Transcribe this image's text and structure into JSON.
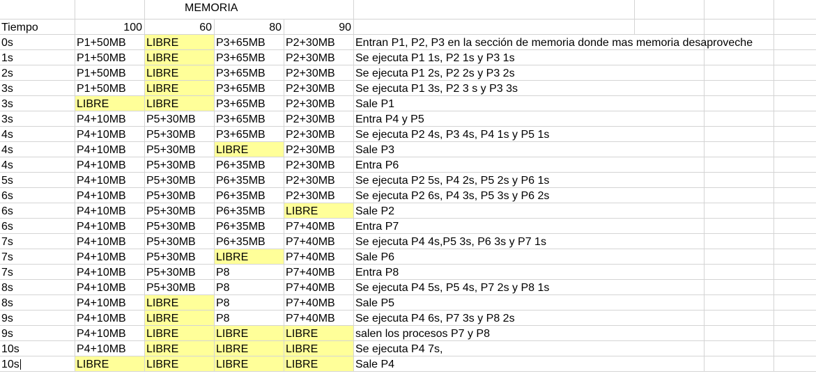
{
  "memoria_label": "MEMORIA",
  "header": {
    "tiempo": "Tiempo",
    "sizes": [
      "100",
      "60",
      "80",
      "90"
    ]
  },
  "rows": [
    {
      "t": "0s",
      "m": [
        "P1+50MB",
        "LIBRE",
        "P3+65MB",
        "P2+30MB"
      ],
      "note": "Entran P1, P2, P3 en la sección de memoria donde mas memoria desaproveche"
    },
    {
      "t": "1s",
      "m": [
        "P1+50MB",
        "LIBRE",
        "P3+65MB",
        "P2+30MB"
      ],
      "note": "Se ejecuta P1 1s, P2 1s y P3 1s"
    },
    {
      "t": "2s",
      "m": [
        "P1+50MB",
        "LIBRE",
        "P3+65MB",
        "P2+30MB"
      ],
      "note": "Se ejecuta P1 2s, P2 2s y P3 2s"
    },
    {
      "t": "3s",
      "m": [
        "P1+50MB",
        "LIBRE",
        "P3+65MB",
        "P2+30MB"
      ],
      "note": "Se ejecuta P1 3s, P2 3 s y P3 3s"
    },
    {
      "t": "3s",
      "m": [
        "LIBRE",
        "LIBRE",
        "P3+65MB",
        "P2+30MB"
      ],
      "note": "Sale P1"
    },
    {
      "t": "3s",
      "m": [
        "P4+10MB",
        "P5+30MB",
        "P3+65MB",
        "P2+30MB"
      ],
      "note": "Entra P4 y P5"
    },
    {
      "t": "4s",
      "m": [
        "P4+10MB",
        "P5+30MB",
        "P3+65MB",
        "P2+30MB"
      ],
      "note": "Se ejecuta P2 4s, P3 4s, P4 1s y P5 1s"
    },
    {
      "t": "4s",
      "m": [
        "P4+10MB",
        "P5+30MB",
        "LIBRE",
        "P2+30MB"
      ],
      "note": "Sale P3"
    },
    {
      "t": "4s",
      "m": [
        "P4+10MB",
        "P5+30MB",
        "P6+35MB",
        "P2+30MB"
      ],
      "note": "Entra P6"
    },
    {
      "t": "5s",
      "m": [
        "P4+10MB",
        "P5+30MB",
        "P6+35MB",
        "P2+30MB"
      ],
      "note": "Se ejecuta P2 5s, P4 2s, P5 2s y P6 1s"
    },
    {
      "t": "6s",
      "m": [
        "P4+10MB",
        "P5+30MB",
        "P6+35MB",
        "P2+30MB"
      ],
      "note": "Se ejecuta P2 6s, P4 3s, P5 3s y P6 2s"
    },
    {
      "t": "6s",
      "m": [
        "P4+10MB",
        "P5+30MB",
        "P6+35MB",
        "LIBRE"
      ],
      "note": "Sale P2"
    },
    {
      "t": "6s",
      "m": [
        "P4+10MB",
        "P5+30MB",
        "P6+35MB",
        "P7+40MB"
      ],
      "note": "Entra P7"
    },
    {
      "t": "7s",
      "m": [
        "P4+10MB",
        "P5+30MB",
        "P6+35MB",
        "P7+40MB"
      ],
      "note": "Se ejecuta P4 4s,P5 3s, P6 3s y P7 1s"
    },
    {
      "t": "7s",
      "m": [
        "P4+10MB",
        "P5+30MB",
        "LIBRE",
        "P7+40MB"
      ],
      "note": "Sale P6"
    },
    {
      "t": "7s",
      "m": [
        "P4+10MB",
        "P5+30MB",
        "P8",
        "P7+40MB"
      ],
      "note": "Entra P8"
    },
    {
      "t": "8s",
      "m": [
        "P4+10MB",
        "P5+30MB",
        "P8",
        "P7+40MB"
      ],
      "note": "Se ejecuta P4 5s, P5 4s, P7 2s y P8 1s"
    },
    {
      "t": "8s",
      "m": [
        "P4+10MB",
        "LIBRE",
        "P8",
        "P7+40MB"
      ],
      "note": "Sale P5"
    },
    {
      "t": "9s",
      "m": [
        "P4+10MB",
        "LIBRE",
        "P8",
        "P7+40MB"
      ],
      "note": "Se ejecuta P4 6s, P7 3s y P8 2s"
    },
    {
      "t": "9s",
      "m": [
        "P4+10MB",
        "LIBRE",
        "LIBRE",
        "LIBRE"
      ],
      "note": "salen los procesos P7 y P8"
    },
    {
      "t": "10s",
      "m": [
        "P4+10MB",
        "LIBRE",
        "LIBRE",
        "LIBRE"
      ],
      "note": "Se ejecuta P4 7s,"
    },
    {
      "t": "10s",
      "m": [
        "LIBRE",
        "LIBRE",
        "LIBRE",
        "LIBRE"
      ],
      "note": "Sale P4"
    }
  ],
  "free_color": "#ffff99",
  "free_label": "LIBRE"
}
